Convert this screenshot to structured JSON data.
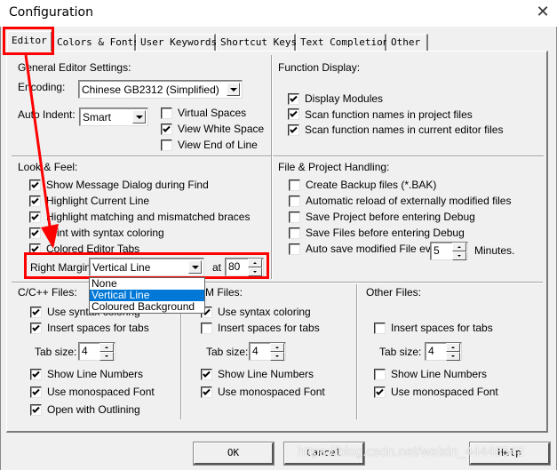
{
  "window": {
    "title": "Configuration",
    "close_icon": "close-icon"
  },
  "tabs": [
    {
      "label": "Editor",
      "active": true
    },
    {
      "label": "Colors & Fonts",
      "active": false
    },
    {
      "label": "User Keywords",
      "active": false
    },
    {
      "label": "Shortcut Keys",
      "active": false
    },
    {
      "label": "Text Completion",
      "active": false
    },
    {
      "label": "Other",
      "active": false
    }
  ],
  "general": {
    "heading": "General Editor Settings:",
    "encoding_label": "Encoding:",
    "encoding_value": "Chinese GB2312 (Simplified)",
    "auto_indent_label": "Auto Indent:",
    "auto_indent_value": "Smart",
    "options": [
      {
        "label": "Virtual Spaces",
        "checked": false
      },
      {
        "label": "View White Space",
        "checked": true
      },
      {
        "label": "View End of Line",
        "checked": false
      }
    ]
  },
  "function_display": {
    "heading": "Function Display:",
    "options": [
      {
        "label": "Display Modules",
        "checked": true
      },
      {
        "label": "Scan function names in project files",
        "checked": true
      },
      {
        "label": "Scan function names in current editor files",
        "checked": true
      }
    ]
  },
  "look_feel": {
    "heading": "Look & Feel:",
    "options": [
      {
        "label": "Show Message Dialog during Find",
        "checked": true
      },
      {
        "label": "Highlight Current Line",
        "checked": true
      },
      {
        "label": "Highlight matching and mismatched braces",
        "checked": true
      },
      {
        "label": "Print with syntax coloring",
        "checked": true
      },
      {
        "label": "Colored Editor Tabs",
        "checked": true
      }
    ],
    "right_margin_label": "Right Margin:",
    "right_margin_value": "Vertical Line",
    "at_label": "at",
    "at_value": "80",
    "dropdown_options": [
      {
        "label": "None",
        "selected": false
      },
      {
        "label": "Vertical Line",
        "selected": true
      },
      {
        "label": "Coloured Background",
        "selected": false
      }
    ]
  },
  "file_project": {
    "heading": "File & Project Handling:",
    "options": [
      {
        "label": "Create Backup files (*.BAK)",
        "checked": false
      },
      {
        "label": "Automatic reload of externally modified files",
        "checked": false
      },
      {
        "label": "Save Project before entering Debug",
        "checked": false
      },
      {
        "label": "Save Files before entering Debug",
        "checked": false
      },
      {
        "label": "Auto save modified File every",
        "checked": false
      }
    ],
    "autosave_value": "5",
    "minutes_label": "Minutes."
  },
  "cpp_files": {
    "heading": "C/C++ Files:",
    "options_top": [
      {
        "label": "Use syntax coloring",
        "checked": true
      },
      {
        "label": "Insert spaces for tabs",
        "checked": true
      }
    ],
    "tab_size_label": "Tab size:",
    "tab_size_value": "4",
    "options_bottom": [
      {
        "label": "Show Line Numbers",
        "checked": true
      },
      {
        "label": "Use monospaced Font",
        "checked": true
      },
      {
        "label": "Open with Outlining",
        "checked": true
      }
    ]
  },
  "asm_files": {
    "heading": "ASM Files:",
    "options_top": [
      {
        "label": "Use syntax coloring",
        "checked": true
      },
      {
        "label": "Insert spaces for tabs",
        "checked": false
      }
    ],
    "tab_size_label": "Tab size:",
    "tab_size_value": "4",
    "options_bottom": [
      {
        "label": "Show Line Numbers",
        "checked": true
      },
      {
        "label": "Use monospaced Font",
        "checked": true
      }
    ]
  },
  "other_files": {
    "heading": "Other Files:",
    "options_top": [
      {
        "label": "Insert spaces for tabs",
        "checked": false
      }
    ],
    "tab_size_label": "Tab size:",
    "tab_size_value": "4",
    "options_bottom": [
      {
        "label": "Show Line Numbers",
        "checked": false
      },
      {
        "label": "Use monospaced Font",
        "checked": true
      }
    ]
  },
  "buttons": {
    "ok": "OK",
    "cancel": "Cancel",
    "help": "Help"
  },
  "annotation": {
    "color": "#ff0000"
  },
  "watermark": "https://blog.csdn.net/weixin_44448542"
}
